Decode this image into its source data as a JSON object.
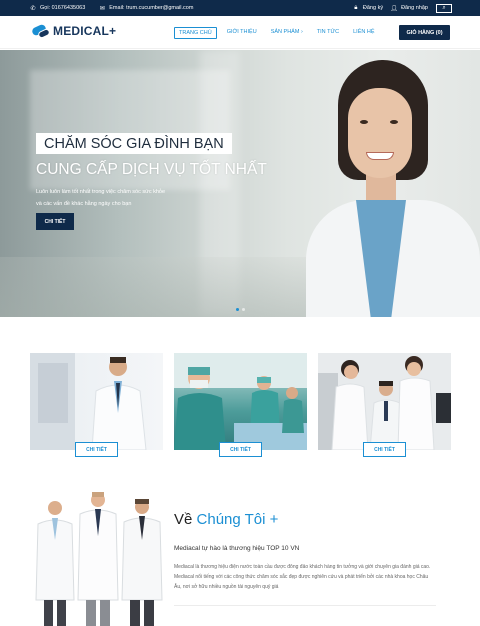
{
  "topbar": {
    "phone": "Gọi: 01676435063",
    "email": "Email: trum.cucumber@gmail.com",
    "register": "Đăng ký",
    "login": "Đăng nhập"
  },
  "header": {
    "logo": "MEDICAL+",
    "nav": [
      "TRANG CHỦ",
      "GIỚI THIỆU",
      "SẢN PHẨM",
      "TIN TỨC",
      "LIÊN HỆ"
    ],
    "cart": "GIỎ HÀNG (0)"
  },
  "hero": {
    "title1": "CHĂM SÓC GIA ĐÌNH BẠN",
    "title2": "CUNG CẤP DỊCH VỤ TỐT NHẤT",
    "desc_line1": "Luôn luôn làm tốt nhất trong việc chăm sóc sức khỏe",
    "desc_line2": "và các vấn đề khác hằng ngày cho bạn",
    "button": "CHI TIẾT"
  },
  "cards": [
    {
      "button": "CHI TIẾT"
    },
    {
      "button": "CHI TIẾT"
    },
    {
      "button": "CHI TIẾT"
    }
  ],
  "about": {
    "title_prefix": "Về",
    "title_highlight": "Chúng Tôi +",
    "subtitle": "Mediacal tự hào là thương hiệu TOP 10 VN",
    "text": "Mediacal là thương hiệu điện nước toàn cầu được đông đảo khách hàng tin tưởng và giới chuyên gia đánh giá cao. Mediacal nổi tiếng với các công thức chăm sóc sắc đẹp được nghiên cứu và phát triển bởi các nhà khoa học Châu Âu, nơi sở hữu nhiều nguồn tài nguyên quý giá"
  },
  "colors": {
    "navy": "#0f2a4a",
    "accent": "#1b8fd3"
  }
}
